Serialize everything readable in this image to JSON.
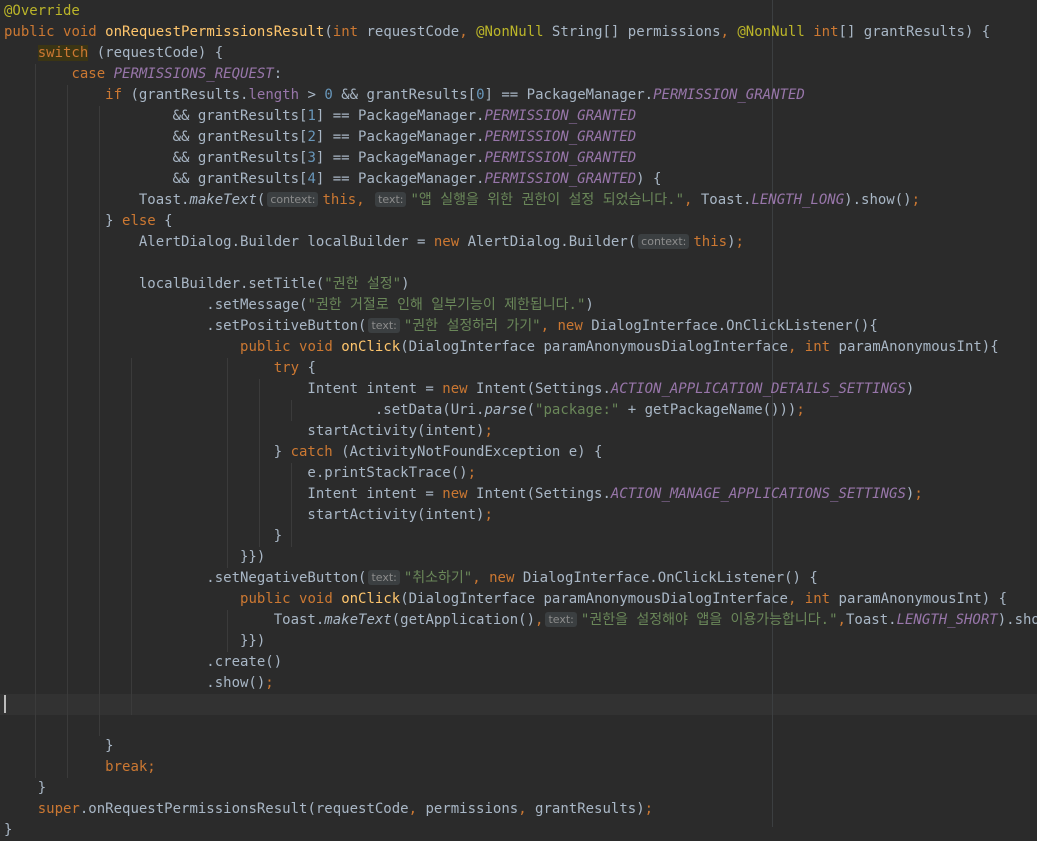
{
  "editor": {
    "lines": [
      [
        {
          "t": "@Override",
          "c": "ann"
        }
      ],
      [
        {
          "t": "public ",
          "c": "kw"
        },
        {
          "t": "void ",
          "c": "kw"
        },
        {
          "t": "onRequestPermissionsResult",
          "c": "fn"
        },
        {
          "t": "("
        },
        {
          "t": "int ",
          "c": "kw"
        },
        {
          "t": "requestCode"
        },
        {
          "t": ", ",
          "c": "kw"
        },
        {
          "t": "@NonNull ",
          "c": "ann"
        },
        {
          "t": "String[] permissions"
        },
        {
          "t": ", ",
          "c": "kw"
        },
        {
          "t": "@NonNull ",
          "c": "ann"
        },
        {
          "t": "int",
          "c": "kw"
        },
        {
          "t": "[] grantResults) {"
        }
      ],
      [
        {
          "t": "    "
        },
        {
          "t": "switch",
          "c": "kw hl"
        },
        {
          "t": " (requestCode) {"
        }
      ],
      [
        {
          "t": "        "
        },
        {
          "t": "case ",
          "c": "kw"
        },
        {
          "t": "PERMISSIONS_REQUEST",
          "c": "sfield"
        },
        {
          "t": ":"
        }
      ],
      [
        {
          "t": "            "
        },
        {
          "t": "if ",
          "c": "kw"
        },
        {
          "t": "(grantResults."
        },
        {
          "t": "length",
          "c": "field"
        },
        {
          "t": " > "
        },
        {
          "t": "0",
          "c": "num"
        },
        {
          "t": " && grantResults["
        },
        {
          "t": "0",
          "c": "num"
        },
        {
          "t": "] == PackageManager."
        },
        {
          "t": "PERMISSION_GRANTED",
          "c": "sfield"
        }
      ],
      [
        {
          "t": "                    && grantResults["
        },
        {
          "t": "1",
          "c": "num"
        },
        {
          "t": "] == PackageManager."
        },
        {
          "t": "PERMISSION_GRANTED",
          "c": "sfield"
        }
      ],
      [
        {
          "t": "                    && grantResults["
        },
        {
          "t": "2",
          "c": "num"
        },
        {
          "t": "] == PackageManager."
        },
        {
          "t": "PERMISSION_GRANTED",
          "c": "sfield"
        }
      ],
      [
        {
          "t": "                    && grantResults["
        },
        {
          "t": "3",
          "c": "num"
        },
        {
          "t": "] == PackageManager."
        },
        {
          "t": "PERMISSION_GRANTED",
          "c": "sfield"
        }
      ],
      [
        {
          "t": "                    && grantResults["
        },
        {
          "t": "4",
          "c": "num"
        },
        {
          "t": "] == PackageManager."
        },
        {
          "t": "PERMISSION_GRANTED",
          "c": "sfield"
        },
        {
          "t": ") {"
        }
      ],
      [
        {
          "t": "                Toast."
        },
        {
          "t": "makeText",
          "c": "smeth"
        },
        {
          "t": "("
        },
        {
          "h": "context:"
        },
        {
          "t": "this",
          "c": "kw"
        },
        {
          "t": ", ",
          "c": "kw"
        },
        {
          "h": "text:"
        },
        {
          "t": "\"앱 실행을 위한 권한이 설정 되었습니다.\"",
          "c": "str"
        },
        {
          "t": ", ",
          "c": "kw"
        },
        {
          "t": "Toast."
        },
        {
          "t": "LENGTH_LONG",
          "c": "sfield"
        },
        {
          "t": ").show()"
        },
        {
          "t": ";",
          "c": "kw"
        }
      ],
      [
        {
          "t": "            } "
        },
        {
          "t": "else ",
          "c": "kw"
        },
        {
          "t": "{"
        }
      ],
      [
        {
          "t": "                AlertDialog.Builder localBuilder = "
        },
        {
          "t": "new ",
          "c": "kw"
        },
        {
          "t": "AlertDialog.Builder("
        },
        {
          "h": "context:"
        },
        {
          "t": "this",
          "c": "kw"
        },
        {
          "t": ")"
        },
        {
          "t": ";",
          "c": "kw"
        }
      ],
      [
        {
          "t": ""
        }
      ],
      [
        {
          "t": "                localBuilder.setTitle("
        },
        {
          "t": "\"권한 설정\"",
          "c": "str"
        },
        {
          "t": ")"
        }
      ],
      [
        {
          "t": "                        .setMessage("
        },
        {
          "t": "\"권한 거절로 인해 일부기능이 제한됩니다.\"",
          "c": "str"
        },
        {
          "t": ")"
        }
      ],
      [
        {
          "t": "                        .setPositiveButton("
        },
        {
          "h": "text:"
        },
        {
          "t": "\"권한 설정하러 가기\"",
          "c": "str"
        },
        {
          "t": ", ",
          "c": "kw"
        },
        {
          "t": "new ",
          "c": "kw"
        },
        {
          "t": "DialogInterface.OnClickListener(){"
        }
      ],
      [
        {
          "t": "                            "
        },
        {
          "t": "public ",
          "c": "kw"
        },
        {
          "t": "void ",
          "c": "kw"
        },
        {
          "t": "onClick",
          "c": "fn"
        },
        {
          "t": "(DialogInterface paramAnonymousDialogInterface"
        },
        {
          "t": ", ",
          "c": "kw"
        },
        {
          "t": "int ",
          "c": "kw"
        },
        {
          "t": "paramAnonymousInt){"
        }
      ],
      [
        {
          "t": "                                "
        },
        {
          "t": "try ",
          "c": "kw"
        },
        {
          "t": "{"
        }
      ],
      [
        {
          "t": "                                    Intent intent = "
        },
        {
          "t": "new ",
          "c": "kw"
        },
        {
          "t": "Intent(Settings."
        },
        {
          "t": "ACTION_APPLICATION_DETAILS_SETTINGS",
          "c": "sfield"
        },
        {
          "t": ")"
        }
      ],
      [
        {
          "t": "                                            .setData(Uri."
        },
        {
          "t": "parse",
          "c": "smeth"
        },
        {
          "t": "("
        },
        {
          "t": "\"package:\"",
          "c": "str"
        },
        {
          "t": " + getPackageName()))"
        },
        {
          "t": ";",
          "c": "kw"
        }
      ],
      [
        {
          "t": "                                    startActivity(intent)"
        },
        {
          "t": ";",
          "c": "kw"
        }
      ],
      [
        {
          "t": "                                } "
        },
        {
          "t": "catch ",
          "c": "kw"
        },
        {
          "t": "(ActivityNotFoundException e) {"
        }
      ],
      [
        {
          "t": "                                    e.printStackTrace()"
        },
        {
          "t": ";",
          "c": "kw"
        }
      ],
      [
        {
          "t": "                                    Intent intent = "
        },
        {
          "t": "new ",
          "c": "kw"
        },
        {
          "t": "Intent(Settings."
        },
        {
          "t": "ACTION_MANAGE_APPLICATIONS_SETTINGS",
          "c": "sfield"
        },
        {
          "t": ")"
        },
        {
          "t": ";",
          "c": "kw"
        }
      ],
      [
        {
          "t": "                                    startActivity(intent)"
        },
        {
          "t": ";",
          "c": "kw"
        }
      ],
      [
        {
          "t": "                                }"
        }
      ],
      [
        {
          "t": "                            }})"
        }
      ],
      [
        {
          "t": "                        .setNegativeButton("
        },
        {
          "h": "text:"
        },
        {
          "t": "\"취소하기\"",
          "c": "str"
        },
        {
          "t": ", ",
          "c": "kw"
        },
        {
          "t": "new ",
          "c": "kw"
        },
        {
          "t": "DialogInterface.OnClickListener() {"
        }
      ],
      [
        {
          "t": "                            "
        },
        {
          "t": "public ",
          "c": "kw"
        },
        {
          "t": "void ",
          "c": "kw"
        },
        {
          "t": "onClick",
          "c": "fn"
        },
        {
          "t": "(DialogInterface paramAnonymousDialogInterface"
        },
        {
          "t": ", ",
          "c": "kw"
        },
        {
          "t": "int ",
          "c": "kw"
        },
        {
          "t": "paramAnonymousInt) {"
        }
      ],
      [
        {
          "t": "                                Toast."
        },
        {
          "t": "makeText",
          "c": "smeth"
        },
        {
          "t": "(getApplication()"
        },
        {
          "t": ",",
          "c": "kw"
        },
        {
          "h": "text:"
        },
        {
          "t": "\"권한을 설정해야 앱을 이용가능합니다.\"",
          "c": "str"
        },
        {
          "t": ",",
          "c": "kw"
        },
        {
          "t": "Toast."
        },
        {
          "t": "LENGTH_SHORT",
          "c": "sfield"
        },
        {
          "t": ").show()"
        },
        {
          "t": ";",
          "c": "kw"
        }
      ],
      [
        {
          "t": "                            }})"
        }
      ],
      [
        {
          "t": "                        .create()"
        }
      ],
      [
        {
          "t": "                        .show()"
        },
        {
          "t": ";",
          "c": "kw"
        }
      ],
      [
        {
          "t": ""
        }
      ],
      [
        {
          "t": ""
        }
      ],
      [
        {
          "t": "            }"
        }
      ],
      [
        {
          "t": "            "
        },
        {
          "t": "break;",
          "c": "kw"
        }
      ],
      [
        {
          "t": "    }"
        }
      ],
      [
        {
          "t": "    "
        },
        {
          "t": "super",
          "c": "kw"
        },
        {
          "t": ".onRequestPermissionsResult(requestCode"
        },
        {
          "t": ", ",
          "c": "kw"
        },
        {
          "t": "permissions"
        },
        {
          "t": ", ",
          "c": "kw"
        },
        {
          "t": "grantResults)"
        },
        {
          "t": ";",
          "c": "kw"
        }
      ],
      [
        {
          "t": "}"
        }
      ]
    ],
    "current_line": 33
  },
  "colors": {
    "background": "#2b2b2b",
    "default_text": "#a9b7c6",
    "keyword": "#cc7832",
    "annotation": "#bbb529",
    "method_declaration": "#ffc66d",
    "string": "#6a8759",
    "number": "#6897bb",
    "field": "#9876aa",
    "inlay_hint": "#8c8c8c"
  }
}
